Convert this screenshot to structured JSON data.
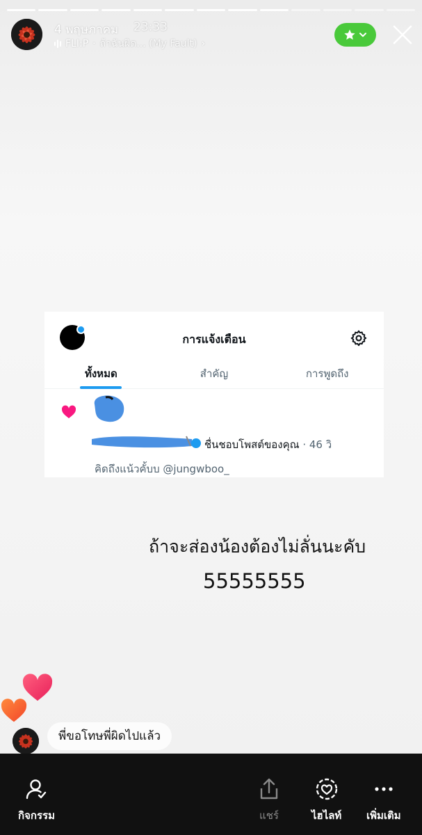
{
  "story": {
    "date": "4 พฤษภาคม",
    "time": "23:33",
    "music_artist": "FLI:P",
    "music_song": "ถ้าฉันผิด... (My Fault)",
    "favorite_color": "#49c93a",
    "icons": {
      "avatar": "red-flower-avatar",
      "music": "music-bars-icon",
      "favorite": "star-icon",
      "close": "close-icon"
    }
  },
  "screenshot": {
    "title": "การแจ้งเตือน",
    "tabs": [
      "ทั้งหมด",
      "สำคัญ",
      "การพูดถึง"
    ],
    "active_tab": "ทั้งหมด",
    "notification": {
      "action": "ชื่นชอบโพสต์ของคุณ",
      "time_ago": "· 46 วิ",
      "post_text": "คิดถึงแน้วคั้บบ @jungwboo_"
    },
    "accent_color": "#1d9bf0"
  },
  "caption": {
    "line1": "ถ้าจะส่องน้องต้องไม่ลั่นนะคับ",
    "line2": "55555555"
  },
  "reply": {
    "text": "พี่ขอโทษพี่ผิดไปแล้ว"
  },
  "bottom_bar": {
    "activity": "กิจกรรม",
    "share": "แชร์",
    "highlight": "ไฮไลท์",
    "more": "เพิ่มเติม"
  }
}
